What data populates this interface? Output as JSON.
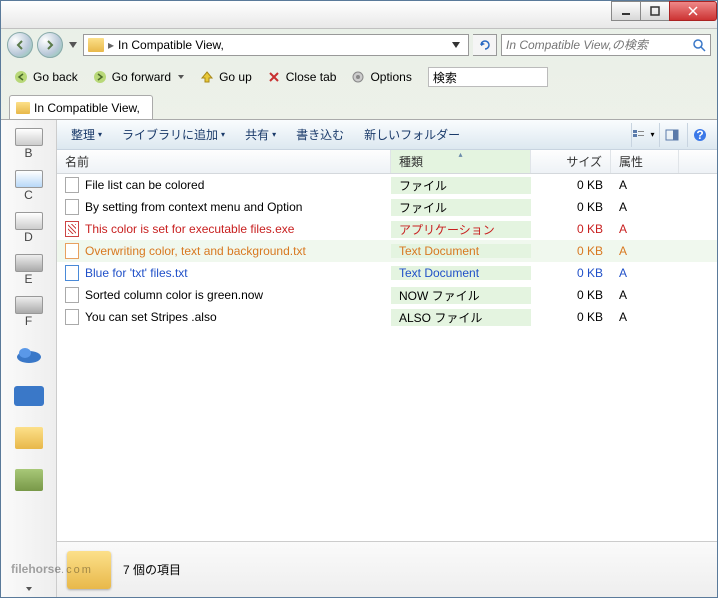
{
  "window": {
    "path_label": "In Compatible View,",
    "search_placeholder": "In Compatible View,の検索"
  },
  "toolbar": {
    "back": "Go back",
    "forward": "Go forward",
    "up": "Go up",
    "close": "Close tab",
    "options": "Options",
    "search": "検索"
  },
  "tab": {
    "label": "In Compatible View,"
  },
  "cmdbar": {
    "organize": "整理",
    "library": "ライブラリに追加",
    "share": "共有",
    "burn": "書き込む",
    "newfolder": "新しいフォルダー"
  },
  "columns": {
    "name": "名前",
    "type": "種類",
    "size": "サイズ",
    "attr": "属性"
  },
  "files": [
    {
      "name": "File list can be colored",
      "type": "ファイル",
      "size": "0 KB",
      "attr": "A",
      "cls": "",
      "icon": "f"
    },
    {
      "name": "By setting from context menu and Option",
      "type": "ファイル",
      "size": "0 KB",
      "attr": "A",
      "cls": "",
      "icon": "f"
    },
    {
      "name": "This color is set for executable files.exe",
      "type": "アプリケーション",
      "size": "0 KB",
      "attr": "A",
      "cls": "row-red",
      "icon": "exe"
    },
    {
      "name": "Overwriting color, text and background.txt",
      "type": "Text Document",
      "size": "0 KB",
      "attr": "A",
      "cls": "row-orange",
      "icon": "txto"
    },
    {
      "name": "Blue for 'txt' files.txt",
      "type": "Text Document",
      "size": "0 KB",
      "attr": "A",
      "cls": "row-blue",
      "icon": "txt"
    },
    {
      "name": "Sorted column color is green.now",
      "type": "NOW ファイル",
      "size": "0 KB",
      "attr": "A",
      "cls": "",
      "icon": "f"
    },
    {
      "name": "You can set Stripes .also",
      "type": "ALSO ファイル",
      "size": "0 KB",
      "attr": "A",
      "cls": "",
      "icon": "f"
    }
  ],
  "sidebar": [
    "B",
    "C",
    "D",
    "E",
    "F"
  ],
  "status": {
    "count": "7 個の項目"
  },
  "watermark": {
    "brand": "filehorse",
    "sub": ".com"
  }
}
